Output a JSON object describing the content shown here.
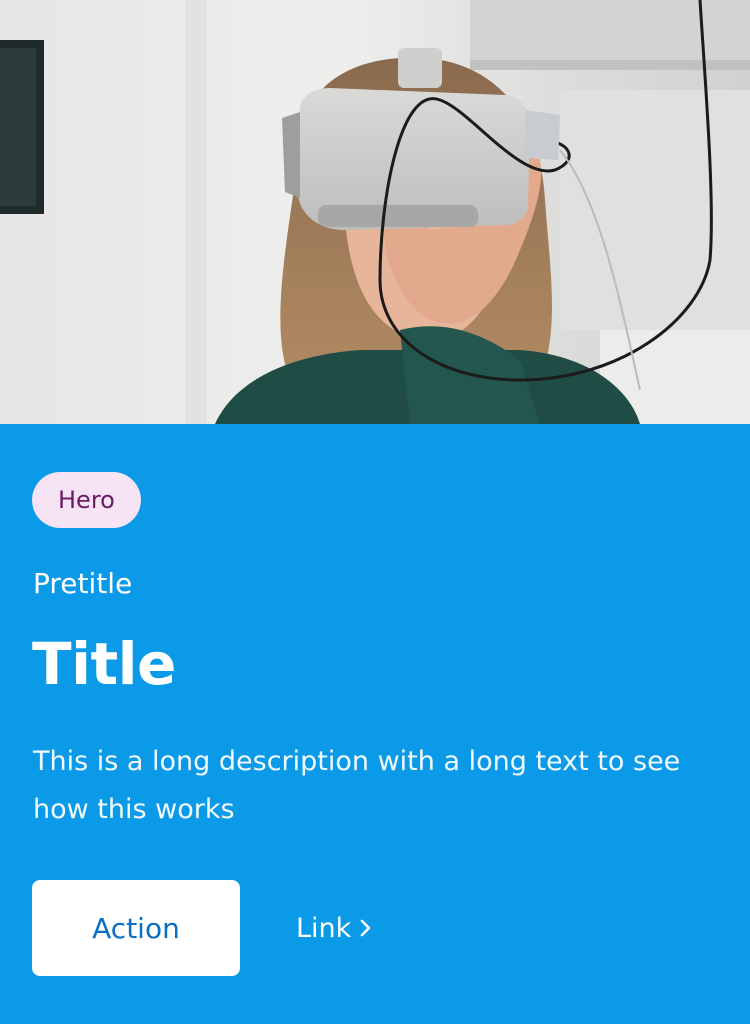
{
  "hero": {
    "tag_label": "Hero",
    "pretitle": "Pretitle",
    "title": "Title",
    "description": "This is a long description with a long text to see how this works",
    "action_label": "Action",
    "link_label": "Link",
    "link_icon": "chevron-right-icon"
  },
  "colors": {
    "background": "#0b9ae8",
    "tag_background": "#f6e3f3",
    "tag_text": "#6b1b66",
    "button_background": "#ffffff",
    "button_text": "#0b6fc4"
  }
}
